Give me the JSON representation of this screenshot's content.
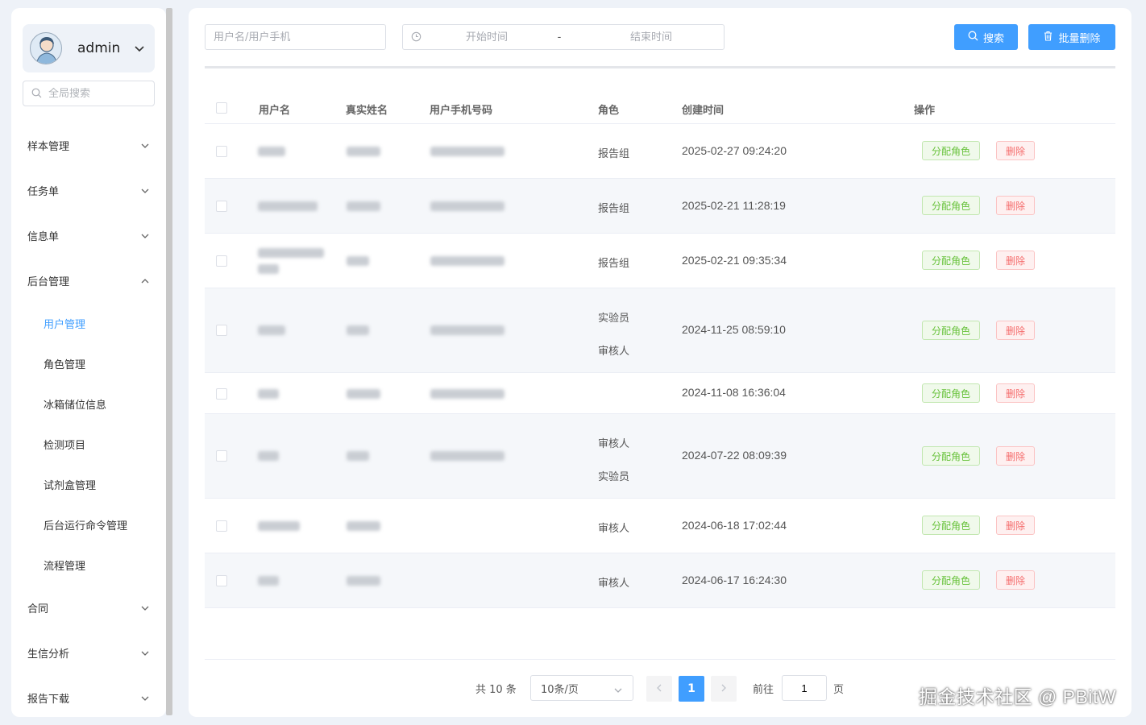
{
  "user": {
    "name": "admin"
  },
  "global_search": {
    "placeholder": "全局搜索"
  },
  "menu": {
    "sample": "样本管理",
    "task": "任务单",
    "info": "信息单",
    "backend": "后台管理",
    "sub": {
      "users": "用户管理",
      "roles": "角色管理",
      "fridge": "冰箱储位信息",
      "tests": "检测项目",
      "kits": "试剂盒管理",
      "commands": "后台运行命令管理",
      "flow": "流程管理"
    },
    "contract": "合同",
    "bio": "生信分析",
    "report": "报告下载"
  },
  "filters": {
    "user_placeholder": "用户名/用户手机",
    "start_placeholder": "开始时间",
    "separator": "-",
    "end_placeholder": "结束时间"
  },
  "actions": {
    "search": "搜索",
    "batch_delete": "批量删除"
  },
  "table": {
    "headers": {
      "username": "用户名",
      "realname": "真实姓名",
      "phone": "用户手机号码",
      "role": "角色",
      "created": "创建时间",
      "ops": "操作"
    },
    "assign_label": "分配角色",
    "delete_label": "删除",
    "rows": [
      {
        "roles": [
          "报告组"
        ],
        "created": "2025-02-27 09:24:20"
      },
      {
        "roles": [
          "报告组"
        ],
        "created": "2025-02-21 11:28:19"
      },
      {
        "roles": [
          "报告组"
        ],
        "created": "2025-02-21 09:35:34"
      },
      {
        "roles": [
          "实验员",
          "审核人"
        ],
        "created": "2024-11-25 08:59:10"
      },
      {
        "roles": [],
        "created": "2024-11-08 16:36:04"
      },
      {
        "roles": [
          "审核人",
          "实验员"
        ],
        "created": "2024-07-22 08:09:39"
      },
      {
        "roles": [
          "审核人"
        ],
        "created": "2024-06-18 17:02:44"
      },
      {
        "roles": [
          "审核人"
        ],
        "created": "2024-06-17 16:24:30"
      }
    ]
  },
  "pagination": {
    "total": "共 10 条",
    "page_size": "10条/页",
    "current": "1",
    "goto": "前往",
    "goto_value": "1",
    "page_unit": "页"
  },
  "watermark": "掘金技术社区 @ PBitW",
  "colors": {
    "primary": "#409eff",
    "success": "#67c23a",
    "danger": "#f56c6c"
  }
}
